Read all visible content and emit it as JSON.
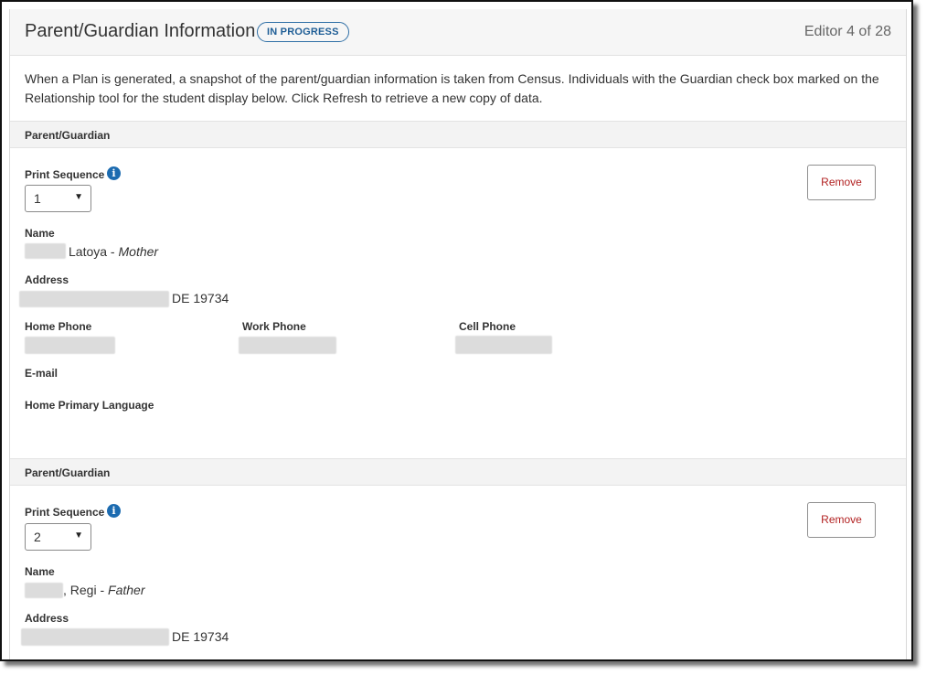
{
  "header": {
    "title": "Parent/Guardian Information",
    "status_badge": "IN PROGRESS",
    "editor_count": "Editor 4 of 28"
  },
  "intro": "When a Plan is generated, a snapshot of the parent/guardian information is taken from Census. Individuals with the Guardian check box marked on the Relationship tool for the student display below. Click Refresh to retrieve a new copy of data.",
  "labels": {
    "section": "Parent/Guardian",
    "print_sequence": "Print Sequence",
    "name": "Name",
    "address": "Address",
    "home_phone": "Home Phone",
    "work_phone": "Work Phone",
    "cell_phone": "Cell Phone",
    "email": "E-mail",
    "home_language": "Home Primary Language",
    "remove": "Remove"
  },
  "guardians": [
    {
      "print_sequence": "1",
      "name": "Latoya",
      "relationship": "Mother",
      "address_tail": "DE 19734"
    },
    {
      "print_sequence": "2",
      "name": ", Regi",
      "relationship": "Father",
      "address_tail": "DE 19734"
    }
  ],
  "icons": {
    "info": "info-icon",
    "dropdown": "chevron-down-icon"
  },
  "colors": {
    "accent": "#1c6bb0",
    "remove_text": "#b22222",
    "section_bg": "#f3f3f3"
  }
}
